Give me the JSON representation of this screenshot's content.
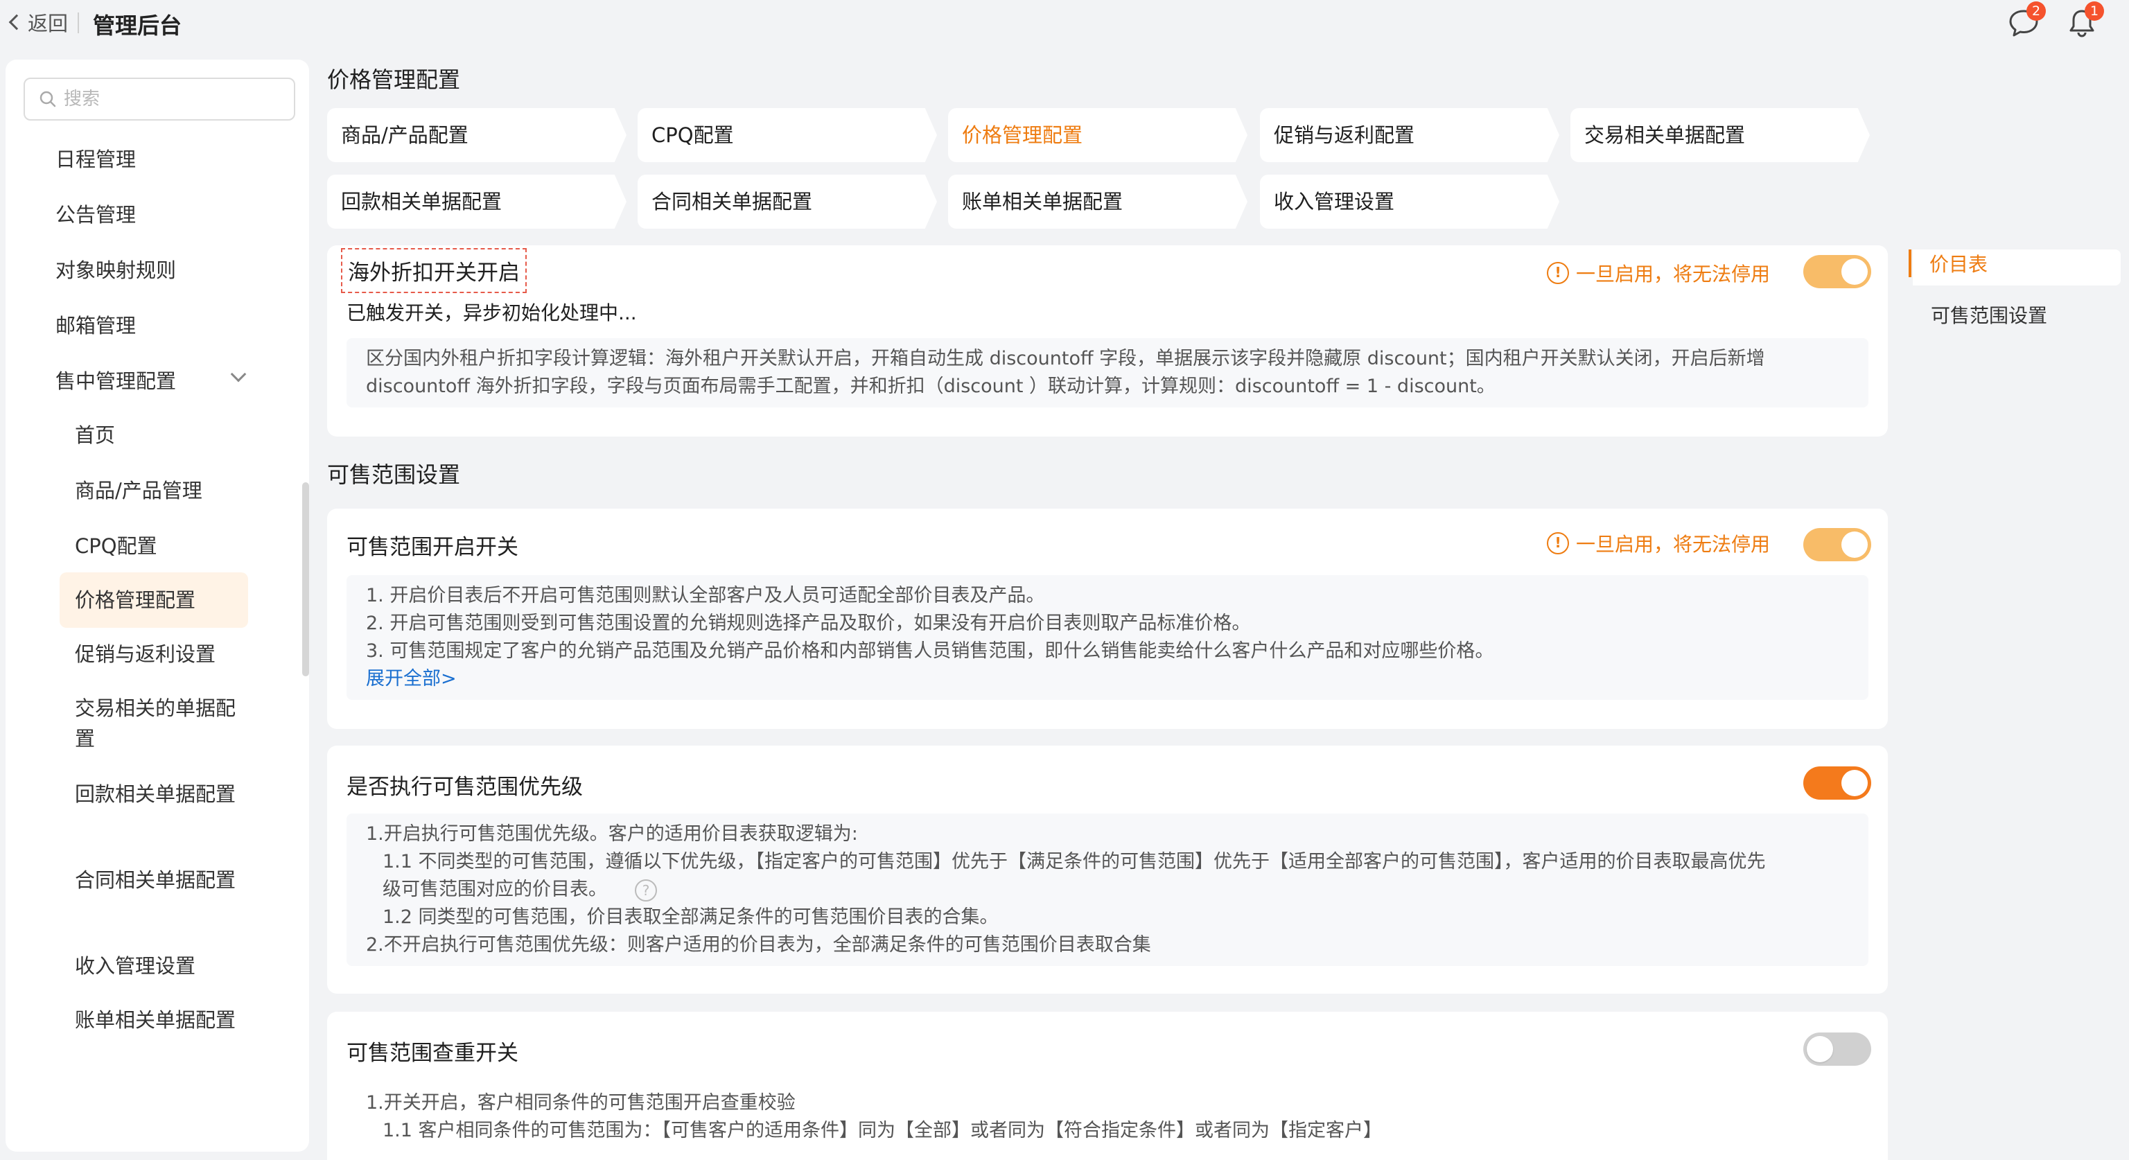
{
  "topbar": {
    "back_label": "返回",
    "title": "管理后台",
    "message_badge": "2",
    "notify_badge": "1"
  },
  "sidebar": {
    "search_placeholder": "搜索",
    "items": [
      {
        "label": "日程管理"
      },
      {
        "label": "公告管理"
      },
      {
        "label": "对象映射规则"
      },
      {
        "label": "邮箱管理"
      },
      {
        "label": "售中管理配置"
      },
      {
        "label": "首页"
      },
      {
        "label": "商品/产品管理"
      },
      {
        "label": "CPQ配置"
      },
      {
        "label": "价格管理配置"
      },
      {
        "label": "促销与返利设置"
      },
      {
        "label": "交易相关的单据配置"
      },
      {
        "label": "回款相关单据配置"
      },
      {
        "label": "合同相关单据配置"
      },
      {
        "label": "收入管理设置"
      },
      {
        "label": "账单相关单据配置"
      }
    ],
    "collapse_glyph": "«"
  },
  "main": {
    "page_title": "价格管理配置",
    "steps": [
      {
        "label": "商品/产品配置"
      },
      {
        "label": "CPQ配置"
      },
      {
        "label": "价格管理配置"
      },
      {
        "label": "促销与返利配置"
      },
      {
        "label": "交易相关单据配置"
      },
      {
        "label": "回款相关单据配置"
      },
      {
        "label": "合同相关单据配置"
      },
      {
        "label": "账单相关单据配置"
      },
      {
        "label": "收入管理设置"
      }
    ],
    "active_step": "价格管理配置",
    "overseas": {
      "title": "海外折扣开关开启",
      "status": "已触发开关，异步初始化处理中...",
      "warning": "一旦启用，将无法停用",
      "note_1": "区分国内外租户折扣字段计算逻辑：海外租户开关默认开启，开箱自动生成 discountoff 字段，单据展示该字段并隐藏原 discount；国内租户开关默认关闭，开启后新增",
      "note_2": "discountoff 海外折扣字段，字段与页面布局需手工配置，并和折扣（discount ）联动计算，计算规则：discountoff = 1 - discount。",
      "toggle_on": true
    },
    "section_2_title": "可售范围设置",
    "range_switch": {
      "title": "可售范围开启开关",
      "warning": "一旦启用，将无法停用",
      "lines": [
        "1. 开启价目表后不开启可售范围则默认全部客户及人员可适配全部价目表及产品。",
        "2. 开启可售范围则受到可售范围设置的允销规则选择产品及取价，如果没有开启价目表则取产品标准价格。",
        "3. 可售范围规定了客户的允销产品范围及允销产品价格和内部销售人员销售范围，即什么销售能卖给什么客户什么产品和对应哪些价格。"
      ],
      "expand_link": "展开全部>",
      "toggle_on": true
    },
    "priority": {
      "title": "是否执行可售范围优先级",
      "line_1": "1.开启执行可售范围优先级。客户的适用价目表获取逻辑为:",
      "line_2": "1.1 不同类型的可售范围，遵循以下优先级，【指定客户的可售范围】优先于【满足条件的可售范围】优先于【适用全部客户的可售范围】，客户适用的价目表取最高优先",
      "line_3": "级可售范围对应的价目表。",
      "line_4": "1.2 同类型的可售范围，价目表取全部满足条件的可售范围价目表的合集。",
      "line_5": "2.不开启执行可售范围优先级：则客户适用的价目表为，全部满足条件的可售范围价目表取合集",
      "help_glyph": "?",
      "toggle_on": true
    },
    "dup_check": {
      "title": "可售范围查重开关",
      "line_1": "1.开关开启，客户相同条件的可售范围开启查重校验",
      "line_2": "1.1 客户相同条件的可售范围为：【可售客户的适用条件】同为【全部】或者同为【符合指定条件】或者同为【指定客户】",
      "toggle_on": false
    }
  },
  "anchor_nav": {
    "items": [
      {
        "label": "价目表"
      },
      {
        "label": "可售范围设置"
      }
    ]
  },
  "colors": {
    "accent": "#ee7c11",
    "toggle_on": "#f47a1c",
    "toggle_on_disabled": "#f8bc68",
    "toggle_off": "#d0d0d0",
    "link": "#1a6fd0",
    "badge": "#f5522d"
  }
}
